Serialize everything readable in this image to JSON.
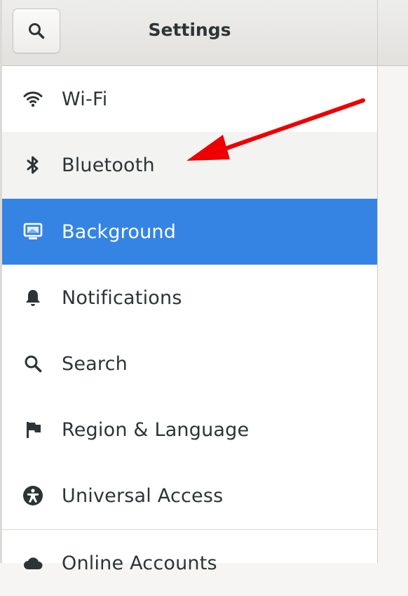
{
  "header": {
    "title": "Settings",
    "search_icon": "search-icon"
  },
  "sidebar": {
    "items": [
      {
        "label": "Wi-Fi",
        "icon": "wifi-icon"
      },
      {
        "label": "Bluetooth",
        "icon": "bluetooth-icon"
      },
      {
        "label": "Background",
        "icon": "background-icon",
        "selected": true
      },
      {
        "label": "Notifications",
        "icon": "bell-icon"
      },
      {
        "label": "Search",
        "icon": "search-icon"
      },
      {
        "label": "Region & Language",
        "icon": "flag-icon"
      },
      {
        "label": "Universal Access",
        "icon": "accessibility-icon"
      },
      {
        "label": "Online Accounts",
        "icon": "cloud-icon"
      }
    ]
  },
  "colors": {
    "accent": "#3584e4",
    "annotation_arrow": "#ee0000"
  }
}
